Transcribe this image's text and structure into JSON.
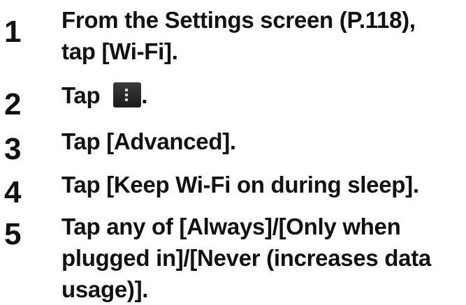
{
  "steps": [
    {
      "number": "1",
      "lines": [
        "From the Settings screen (P.118),",
        "tap [Wi-Fi]."
      ]
    },
    {
      "number": "2",
      "before_icon": "Tap ",
      "icon": "menu-icon",
      "after_icon": "."
    },
    {
      "number": "3",
      "lines": [
        "Tap [Advanced]."
      ]
    },
    {
      "number": "4",
      "lines": [
        "Tap [Keep Wi-Fi on during sleep]."
      ]
    },
    {
      "number": "5",
      "lines": [
        "Tap any of [Always]/[Only when",
        "plugged in]/[Never (increases data",
        "usage)]."
      ]
    }
  ]
}
